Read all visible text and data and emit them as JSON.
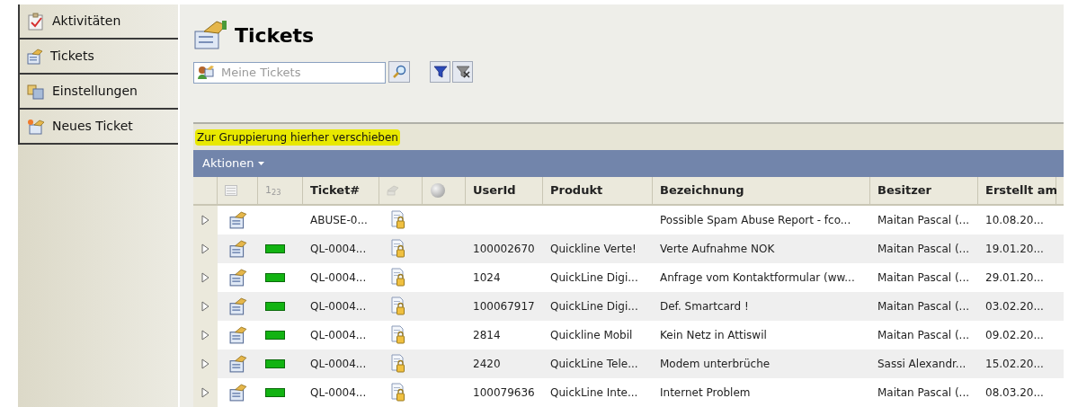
{
  "sidebar": {
    "items": [
      {
        "label": "Aktivitäten",
        "kind": "activities"
      },
      {
        "label": "Tickets",
        "kind": "tickets"
      },
      {
        "label": "Einstellungen",
        "kind": "settings"
      },
      {
        "label": "Neues Ticket",
        "kind": "new"
      }
    ]
  },
  "page": {
    "title": "Tickets"
  },
  "search": {
    "placeholder": "Meine Tickets"
  },
  "group_bar": {
    "text": "Zur Gruppierung hierher verschieben"
  },
  "actions_menu": {
    "label": "Aktionen"
  },
  "table": {
    "columns": [
      {
        "kind": "expander"
      },
      {
        "kind": "type-icon"
      },
      {
        "kind": "index",
        "label": "1$_{2}$$_{3}$"
      },
      {
        "kind": "text",
        "label": "Ticket#"
      },
      {
        "kind": "lock-icon"
      },
      {
        "kind": "circle-icon"
      },
      {
        "kind": "text",
        "label": "UserId"
      },
      {
        "kind": "text",
        "label": "Produkt"
      },
      {
        "kind": "text",
        "label": "Bezeichnung"
      },
      {
        "kind": "text",
        "label": "Besitzer"
      },
      {
        "kind": "text",
        "label": "Erstellt am"
      }
    ],
    "rows": [
      {
        "status": false,
        "ticket": "ABUSE-0...",
        "user_id": "",
        "product": "",
        "title": "Possible Spam Abuse Report - fco...",
        "owner": "Maitan Pascal (...",
        "created": "10.08.20..."
      },
      {
        "status": true,
        "ticket": "QL-0004...",
        "user_id": "100002670",
        "product": "Quickline Verte!",
        "title": "Verte Aufnahme NOK",
        "owner": "Maitan Pascal (...",
        "created": "19.01.20..."
      },
      {
        "status": true,
        "ticket": "QL-0004...",
        "user_id": "1024",
        "product": "QuickLine Digi...",
        "title": "Anfrage vom Kontaktformular (ww...",
        "owner": "Maitan Pascal (...",
        "created": "29.01.20..."
      },
      {
        "status": true,
        "ticket": "QL-0004...",
        "user_id": "100067917",
        "product": "QuickLine Digi...",
        "title": "Def. Smartcard !",
        "owner": "Maitan Pascal (...",
        "created": "03.02.20..."
      },
      {
        "status": true,
        "ticket": "QL-0004...",
        "user_id": "2814",
        "product": "Quickline Mobil",
        "title": "Kein Netz in Attiswil",
        "owner": "Maitan Pascal (...",
        "created": "09.02.20..."
      },
      {
        "status": true,
        "ticket": "QL-0004...",
        "user_id": "2420",
        "product": "QuickLine Tele...",
        "title": "Modem unterbrüche",
        "owner": "Sassi Alexandr...",
        "created": "15.02.20..."
      },
      {
        "status": true,
        "ticket": "QL-0004...",
        "user_id": "100079636",
        "product": "QuickLine Inte...",
        "title": "Internet Problem",
        "owner": "Maitan Pascal (...",
        "created": "08.03.20..."
      }
    ]
  }
}
